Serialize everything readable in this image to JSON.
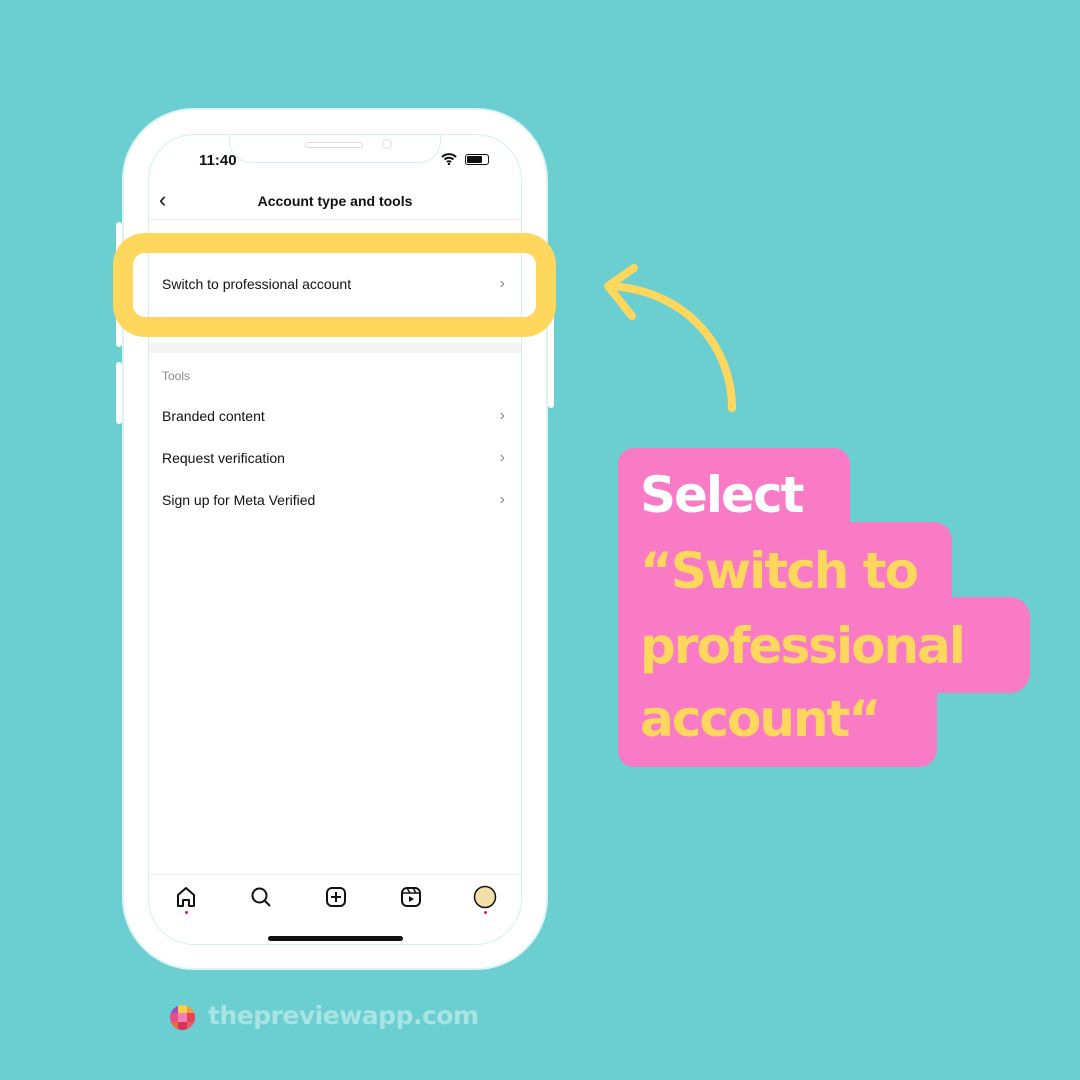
{
  "status_bar": {
    "time": "11:40"
  },
  "header": {
    "title": "Account type and tools"
  },
  "account_row": {
    "label": "Switch to professional account"
  },
  "tools": {
    "section_label": "Tools",
    "items": [
      {
        "label": "Branded content"
      },
      {
        "label": "Request verification"
      },
      {
        "label": "Sign up for Meta Verified"
      }
    ]
  },
  "bottom_nav": [
    "home-icon",
    "search-icon",
    "create-icon",
    "reels-icon",
    "profile-avatar"
  ],
  "callout": {
    "line1": "Select",
    "line2": "“Switch to",
    "line3": "professional",
    "line4": "account“"
  },
  "brand": {
    "text": "thepreviewapp.com"
  },
  "colors": {
    "background": "#6BCFD2",
    "highlight": "#FFD75C",
    "callout": "#F97AC5",
    "callout_text_white": "#FFFFFF",
    "callout_text_yellow": "#FFD75C"
  }
}
